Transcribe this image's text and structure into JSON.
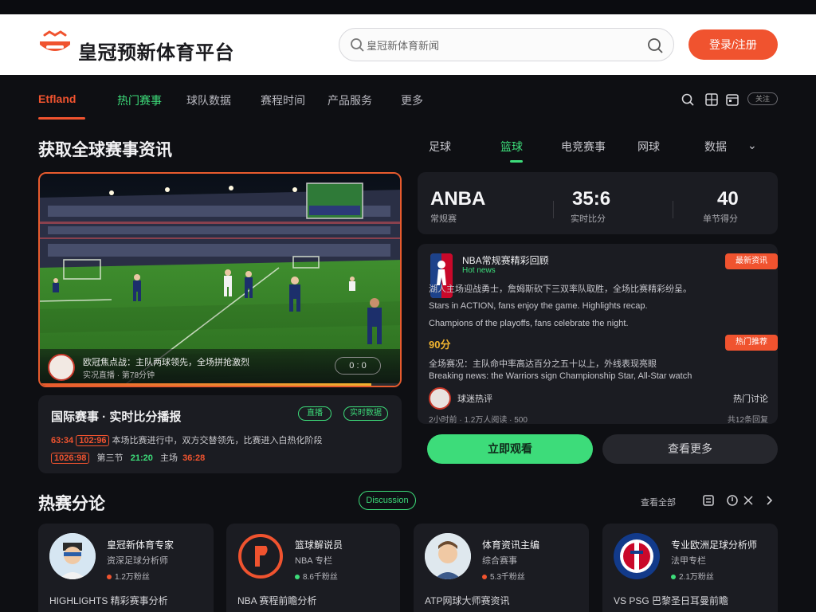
{
  "header": {
    "brand": "皇冠预新体育平台",
    "search_placeholder": "皇冠新体育新闻",
    "cta": "登录/注册"
  },
  "nav": {
    "items": [
      {
        "label": "Etfland",
        "state": "active"
      },
      {
        "label": "热门赛事",
        "state": "green"
      },
      {
        "label": "球队数据",
        "state": "normal"
      },
      {
        "label": "赛程时间",
        "state": "normal"
      },
      {
        "label": "产品服务",
        "state": "normal"
      },
      {
        "label": "更多",
        "state": "normal"
      }
    ],
    "pill": "关注"
  },
  "hero_section": {
    "title": "获取全球赛事资讯",
    "tabs": [
      {
        "label": "足球",
        "state": "normal"
      },
      {
        "label": "篮球",
        "state": "active"
      },
      {
        "label": "电竞赛事",
        "state": "normal"
      },
      {
        "label": "网球",
        "state": "normal"
      },
      {
        "label": "数据",
        "state": "normal"
      }
    ],
    "tab_more": "⌄"
  },
  "hero_video": {
    "caption_line1": "欧冠焦点战：主队两球领先，全场拼抢激烈",
    "caption_line2": "实况直播 · 第78分钟",
    "pill": "0 : 0",
    "progress": 0.92
  },
  "live_card": {
    "title": "国际赛事 · 实时比分播报",
    "badge1": "直播",
    "badge2": "实时数据",
    "row1": {
      "prefix_hl": "63:34",
      "boxed": "102:96",
      "text": "本场比赛进行中，双方交替领先，比赛进入白热化阶段"
    },
    "row2": {
      "left_hl": "1026:98",
      "mid1": "第三节",
      "mid_green": "21:20",
      "mid2": "主场",
      "right_hl": "36:28"
    }
  },
  "score_card": {
    "league": "ANBA",
    "league_sub": "常规赛",
    "score": "35:6",
    "score_sub": "实时比分",
    "points": "40",
    "points_sub": "单节得分"
  },
  "news_card": {
    "title": "NBA常规赛精彩回顾",
    "subtitle": "Hot news",
    "tag1": "最新资讯",
    "tag2": "热门推荐",
    "line1": "湖人主场迎战勇士，詹姆斯砍下三双率队取胜，全场比赛精彩纷呈。",
    "line2": "Stars in ACTION, fans enjoy the game. Highlights recap.",
    "line3": "Champions of the playoffs, fans celebrate the night.",
    "highlight": "90分",
    "line4": "全场赛况：主队命中率高达百分之五十以上，外线表现亮眼",
    "line5": "Breaking news: the Warriors sign Championship Star, All-Star watch",
    "mini_title": "球迷热评",
    "mini_meta": "2小时前 · 1.2万人阅读 · 500",
    "right_meta": "热门讨论",
    "right_meta2": "共12条回复"
  },
  "actions": {
    "primary": "立即观看",
    "secondary": "查看更多"
  },
  "section2": {
    "title": "热赛分论",
    "pill": "Discussion",
    "right_text": "查看全部"
  },
  "players": [
    {
      "name": "皇冠新体育专家",
      "role": "资深足球分析师",
      "meta": "1.2万粉丝",
      "desc": "HIGHLIGHTS 精彩赛事分析",
      "dot": "#f0532f"
    },
    {
      "name": "篮球解说员",
      "role": "NBA 专栏",
      "meta": "8.6千粉丝",
      "desc": "NBA 赛程前瞻分析",
      "dot": "#3ddc7a"
    },
    {
      "name": "体育资讯主编",
      "role": "综合赛事",
      "meta": "5.3千粉丝",
      "desc": "ATP网球大师赛资讯",
      "dot": "#f0532f"
    },
    {
      "name": "专业欧洲足球分析师",
      "role": "法甲专栏",
      "meta": "2.1万粉丝",
      "desc": "VS PSG 巴黎圣日耳曼前瞻",
      "dot": "#3ddc7a"
    }
  ],
  "colors": {
    "accent": "#f0532f",
    "green": "#3ddc7a",
    "bg": "#0e0f13",
    "card": "#1b1c22"
  }
}
